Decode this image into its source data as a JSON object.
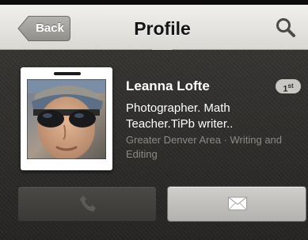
{
  "nav": {
    "back_label": "Back",
    "title": "Profile",
    "search_icon": "search-icon"
  },
  "profile": {
    "name": "Leanna Lofte",
    "degree": "1",
    "degree_suffix": "st",
    "headline": "Photographer. Math Teacher.TiPb writer..",
    "location": "Greater Denver Area · Writing and Editing"
  },
  "actions": {
    "call_icon": "phone-icon",
    "message_icon": "envelope-icon"
  },
  "colors": {
    "nav_background": "#e6e5e0",
    "back_button": "#a6a5a0",
    "content_background": "#2b2a28",
    "secondary_text": "#8c8a85"
  }
}
